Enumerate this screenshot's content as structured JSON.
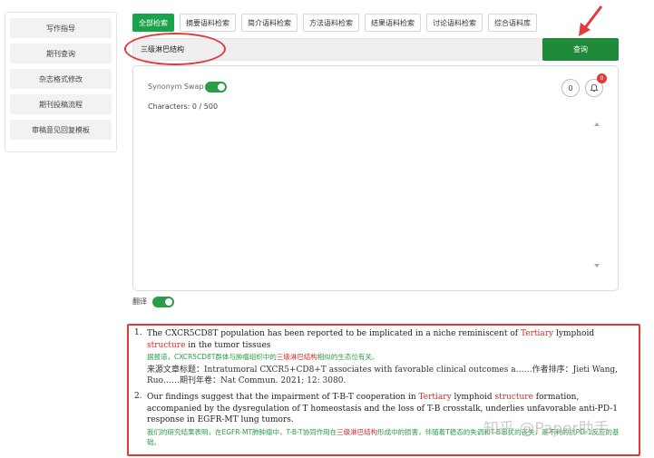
{
  "sidebar": {
    "items": [
      "写作指导",
      "期刊查询",
      "杂志格式修改",
      "期刊投稿流程",
      "审稿意见回复模板"
    ]
  },
  "tabs": [
    "全部检索",
    "摘要语料检索",
    "简介语料检索",
    "方法语料检索",
    "结果语料检索",
    "讨论语料检索",
    "综合语料库"
  ],
  "search": {
    "value": "三级淋巴结构",
    "button": "查询"
  },
  "panel": {
    "synonym_swap_label": "Synonym Swap",
    "synonym_swap_on": true,
    "characters_label": "Characters:",
    "characters_value": "0 / 500",
    "count_value": "0",
    "badge_value": "0"
  },
  "translate": {
    "label": "翻译",
    "on": true
  },
  "results": [
    {
      "num": "1.",
      "en": [
        {
          "t": "The CXCR5CD8T population has been reported to be implicated in a niche reminiscent of "
        },
        {
          "t": "Tertiary",
          "hl": true
        },
        {
          "t": " lymphoid "
        },
        {
          "t": "structure",
          "hl": true
        },
        {
          "t": " in the tumor tissues"
        }
      ],
      "zh": [
        {
          "t": "据报道，CXCR5CD8T群体与肿瘤组织中的"
        },
        {
          "t": "三级淋巴结构",
          "hl": true
        },
        {
          "t": "相似的生态位有关。"
        }
      ],
      "source": "来源文章标题：Intratumoral CXCR5+CD8+T associates with favorable clinical outcomes a……作者排序：Jieti Wang, Ruo……期刊年卷：Nat Commun. 2021; 12: 3080."
    },
    {
      "num": "2.",
      "en": [
        {
          "t": "Our findings suggest that the impairment of T-B-T cooperation in "
        },
        {
          "t": "Tertiary",
          "hl": true
        },
        {
          "t": " lymphoid "
        },
        {
          "t": "structure",
          "hl": true
        },
        {
          "t": " formation, accompanied by the dysregulation of T homeostasis and the loss of T-B crosstalk, underlies unfavorable anti-PD-1 response in EGFR-MT lung tumors."
        }
      ],
      "zh": [
        {
          "t": "我们的研究结果表明，在EGFR-MT肺肿瘤中，T-B-T协同作用在"
        },
        {
          "t": "三级淋巴结构",
          "hl": true
        },
        {
          "t": "形成中的损害，伴随着T稳态的失调和T-B串扰的丧失，是不利的抗PD-1反应的基础。"
        }
      ],
      "source": ""
    }
  ],
  "watermark": "知乎 @Paper助手",
  "colors": {
    "green": "#1aa34a",
    "dark_green": "#1e8a3a",
    "red": "#e23a3a",
    "highlight": "#d62828"
  }
}
